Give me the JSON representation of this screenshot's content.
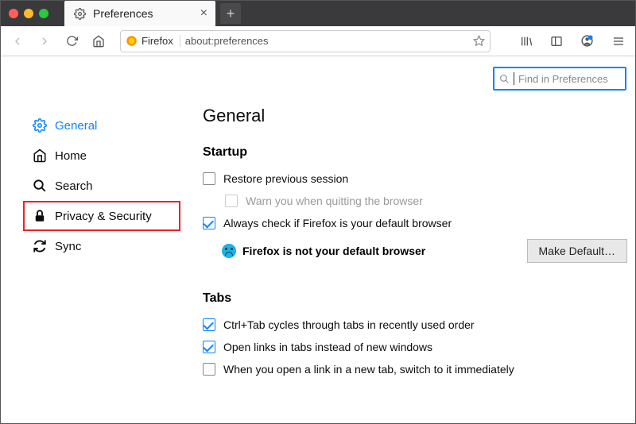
{
  "window": {
    "tab_title": "Preferences"
  },
  "urlbar": {
    "identity": "Firefox",
    "url": "about:preferences"
  },
  "search": {
    "placeholder": "Find in Preferences"
  },
  "sidebar": {
    "items": [
      {
        "label": "General"
      },
      {
        "label": "Home"
      },
      {
        "label": "Search"
      },
      {
        "label": "Privacy & Security"
      },
      {
        "label": "Sync"
      }
    ]
  },
  "main": {
    "heading": "General",
    "startup": {
      "title": "Startup",
      "restore_label": "Restore previous session",
      "warn_quit_label": "Warn you when quitting the browser",
      "always_check_label": "Always check if Firefox is your default browser",
      "status_text": "Firefox is not your default browser",
      "make_default_label": "Make Default…"
    },
    "tabs": {
      "title": "Tabs",
      "ctrl_tab_label": "Ctrl+Tab cycles through tabs in recently used order",
      "open_links_label": "Open links in tabs instead of new windows",
      "switch_new_tab_label": "When you open a link in a new tab, switch to it immediately"
    }
  }
}
